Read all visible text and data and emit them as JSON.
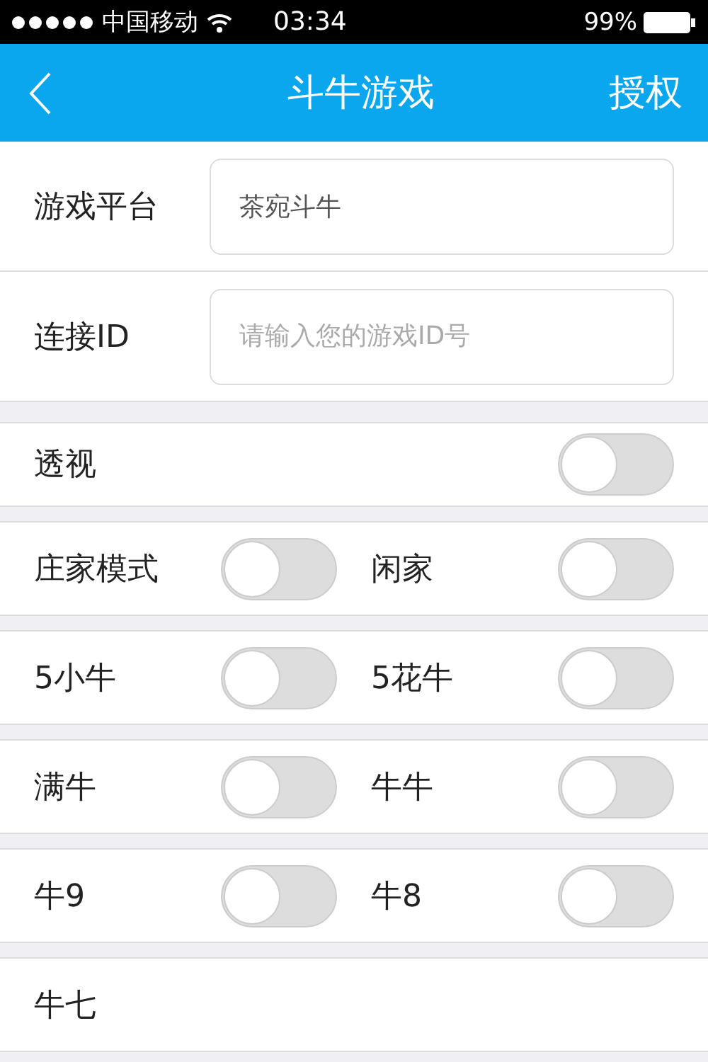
{
  "status_bar": {
    "carrier": "中国移动",
    "time": "03:34",
    "battery": "99%"
  },
  "nav": {
    "title": "斗牛游戏",
    "action": "授权"
  },
  "fields": [
    {
      "label": "游戏平台",
      "value": "茶宛斗牛"
    },
    {
      "label": "连接ID",
      "placeholder": "请输入您的游戏ID号"
    }
  ],
  "switch_rows": [
    {
      "items": [
        {
          "kind": "toggle",
          "label": "透视",
          "on": false
        }
      ]
    },
    {
      "items": [
        {
          "kind": "toggle",
          "label": "庄家模式",
          "on": false
        },
        {
          "kind": "toggle",
          "label": "闲家",
          "on": false
        }
      ]
    },
    {
      "items": [
        {
          "kind": "toggle",
          "label": "5小牛",
          "on": false
        },
        {
          "kind": "toggle",
          "label": "5花牛",
          "on": false
        }
      ]
    },
    {
      "items": [
        {
          "kind": "toggle",
          "label": "满牛",
          "on": false
        },
        {
          "kind": "toggle",
          "label": "牛牛",
          "on": false
        }
      ]
    },
    {
      "items": [
        {
          "kind": "toggle",
          "label": "牛9",
          "on": false
        },
        {
          "kind": "toggle",
          "label": "牛8",
          "on": false
        }
      ]
    },
    {
      "items": [
        {
          "kind": "label",
          "label": "牛七"
        }
      ]
    }
  ]
}
